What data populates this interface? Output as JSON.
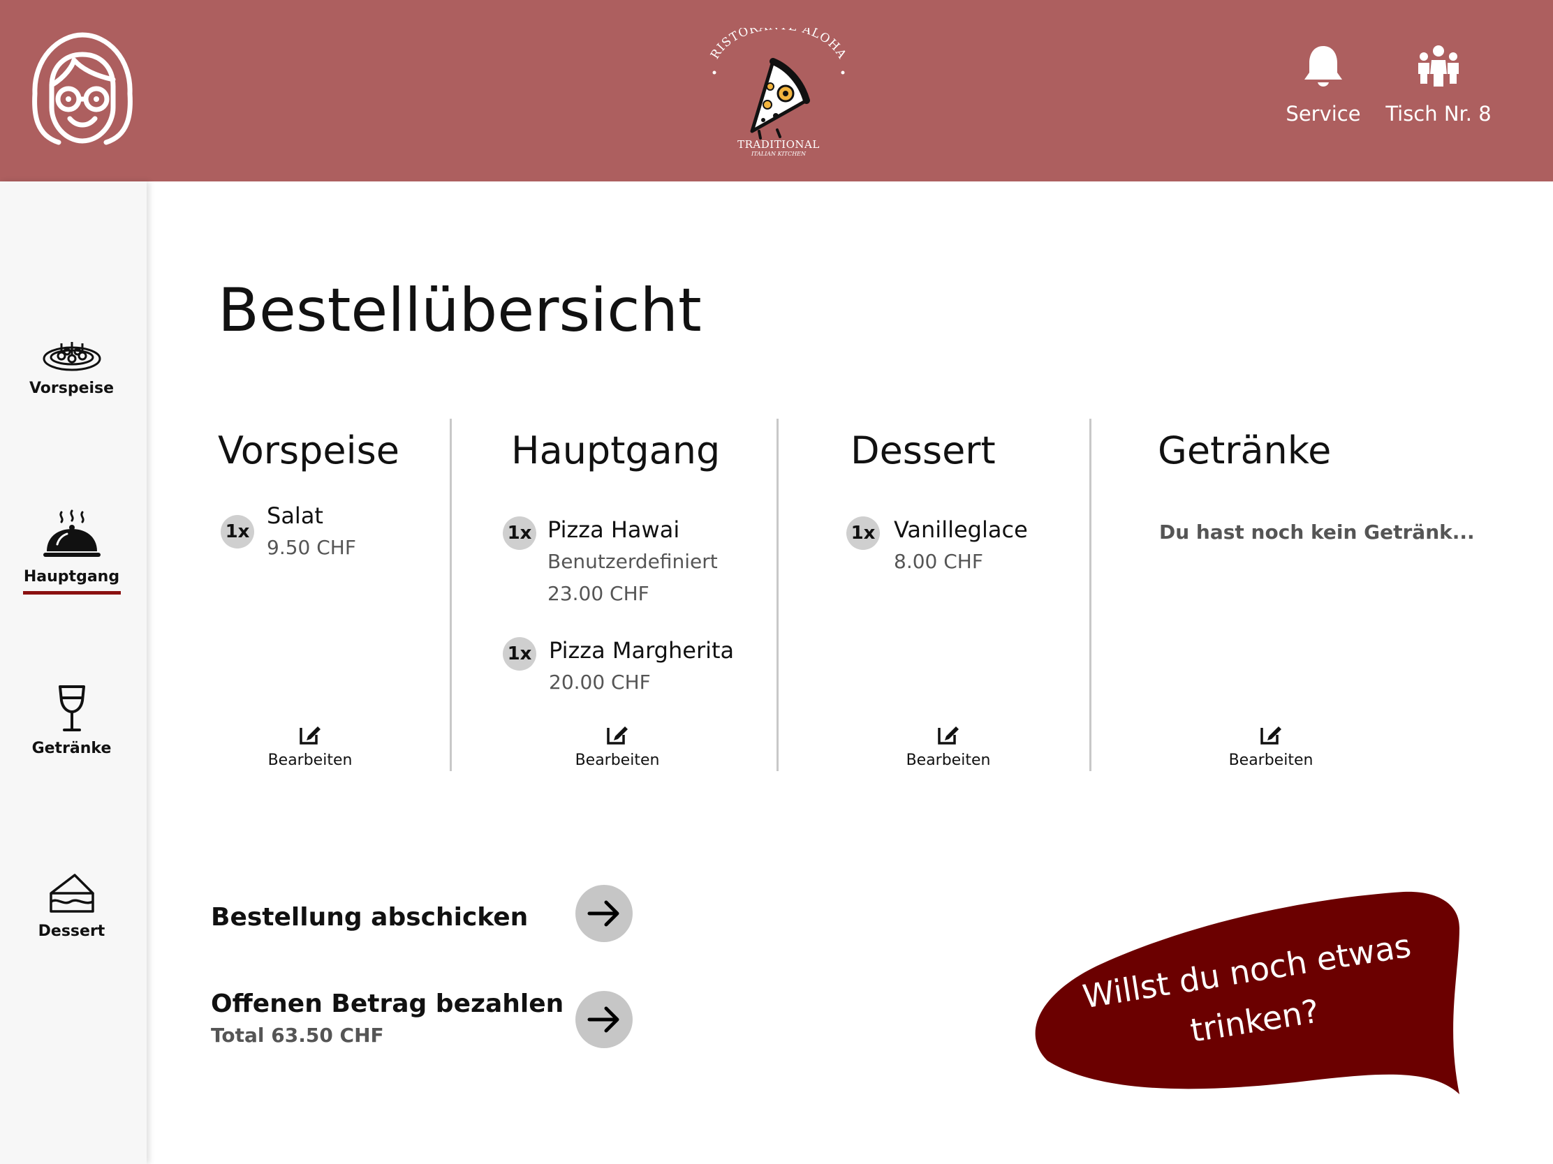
{
  "header": {
    "logo": {
      "arc_text": "RISTORANTE ALOHA",
      "traditional": "TRADITIONAL",
      "subtitle": "ITALIAN KITCHEN"
    },
    "service_label": "Service",
    "table_label": "Tisch Nr. 8",
    "background": "#ad5f5f"
  },
  "sidebar": {
    "items": [
      {
        "label": "Vorspeise",
        "icon": "appetizer-plate-icon",
        "active": false
      },
      {
        "label": "Hauptgang",
        "icon": "cloche-icon",
        "active": true
      },
      {
        "label": "Getränke",
        "icon": "wine-glass-icon",
        "active": false
      },
      {
        "label": "Dessert",
        "icon": "cake-slice-icon",
        "active": false
      }
    ],
    "active_color": "#8a1010"
  },
  "main": {
    "title": "Bestellübersicht",
    "columns": [
      {
        "heading": "Vorspeise",
        "items": [
          {
            "qty": "1x",
            "name": "Salat",
            "price": "9.50 CHF"
          }
        ],
        "edit_label": "Bearbeiten"
      },
      {
        "heading": "Hauptgang",
        "items": [
          {
            "qty": "1x",
            "name": "Pizza Hawai",
            "note": "Benutzerdefiniert",
            "price": "23.00 CHF"
          },
          {
            "qty": "1x",
            "name": "Pizza Margherita",
            "price": "20.00 CHF"
          }
        ],
        "edit_label": "Bearbeiten"
      },
      {
        "heading": "Dessert",
        "items": [
          {
            "qty": "1x",
            "name": "Vanilleglace",
            "price": "8.00 CHF"
          }
        ],
        "edit_label": "Bearbeiten"
      },
      {
        "heading": "Getränke",
        "empty_text": "Du hast noch kein Getränk...",
        "edit_label": "Bearbeiten"
      }
    ],
    "actions": {
      "submit_label": "Bestellung abschicken",
      "pay_label": "Offenen Betrag bezahlen",
      "total_label": "Total 63.50 CHF"
    },
    "bubble": {
      "line1": "Willst du noch etwas",
      "line2": "trinken?",
      "color": "#6b0000"
    }
  }
}
